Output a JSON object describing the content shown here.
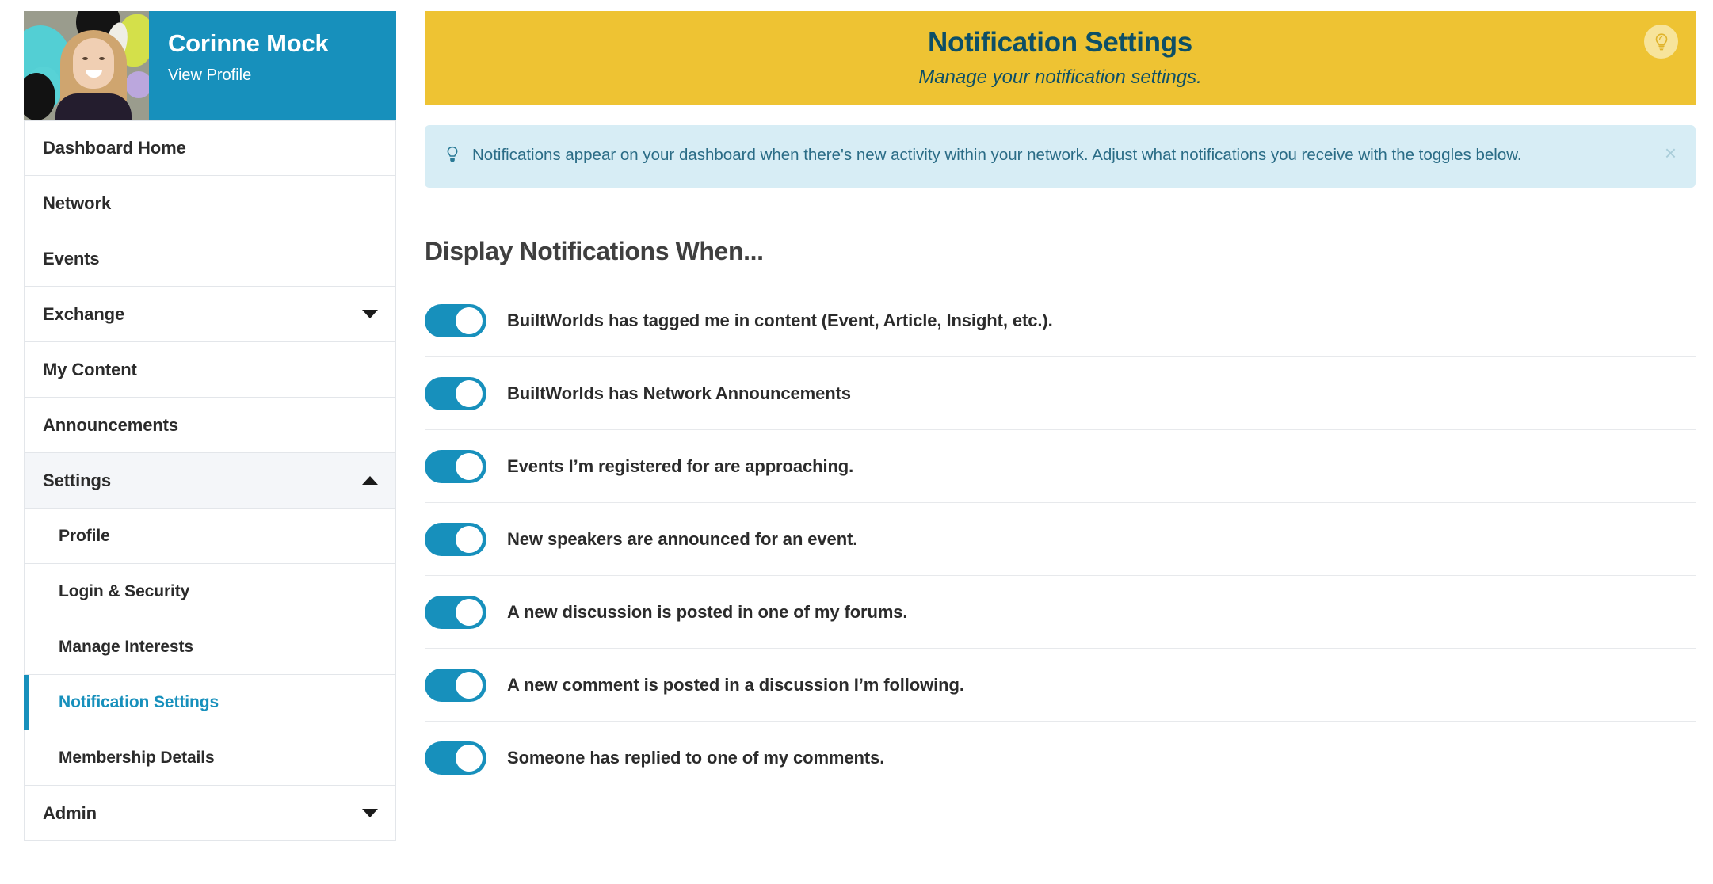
{
  "sidebar": {
    "profile": {
      "name": "Corinne Mock",
      "view_profile_label": "View Profile",
      "avatar_alt": "avatar",
      "background_color": "#1790BC"
    },
    "items": [
      {
        "label": "Dashboard Home",
        "type": "top",
        "caret": "none",
        "state": "default"
      },
      {
        "label": "Network",
        "type": "top",
        "caret": "none",
        "state": "default"
      },
      {
        "label": "Events",
        "type": "top",
        "caret": "none",
        "state": "default"
      },
      {
        "label": "Exchange",
        "type": "top",
        "caret": "down",
        "state": "default"
      },
      {
        "label": "My Content",
        "type": "top",
        "caret": "none",
        "state": "default"
      },
      {
        "label": "Announcements",
        "type": "top",
        "caret": "none",
        "state": "default"
      },
      {
        "label": "Settings",
        "type": "top",
        "caret": "up",
        "state": "expanded"
      },
      {
        "label": "Profile",
        "type": "sub",
        "caret": "none",
        "state": "default"
      },
      {
        "label": "Login & Security",
        "type": "sub",
        "caret": "none",
        "state": "default"
      },
      {
        "label": "Manage Interests",
        "type": "sub",
        "caret": "none",
        "state": "default"
      },
      {
        "label": "Notification Settings",
        "type": "sub",
        "caret": "none",
        "state": "active"
      },
      {
        "label": "Membership Details",
        "type": "sub",
        "caret": "none",
        "state": "default"
      },
      {
        "label": "Admin",
        "type": "top",
        "caret": "down",
        "state": "default"
      }
    ]
  },
  "hero": {
    "title": "Notification Settings",
    "subtitle": "Manage your notification settings.",
    "background_color": "#EEC333",
    "text_color": "#0d4f66",
    "badge_icon": "lightbulb-icon"
  },
  "info_banner": {
    "icon": "lightbulb-icon",
    "text": "Notifications appear on your dashboard when there's new activity within your network. Adjust what notifications you receive with the toggles below.",
    "close_label": "×",
    "background_color": "#d7edf5",
    "text_color": "#2a6c86"
  },
  "notifications": {
    "section_title": "Display Notifications When...",
    "toggle_on_color": "#1790BC",
    "items": [
      {
        "label": "BuiltWorlds has tagged me in content (Event, Article, Insight, etc.).",
        "enabled": true
      },
      {
        "label": "BuiltWorlds has Network Announcements",
        "enabled": true
      },
      {
        "label": "Events I’m registered for are approaching.",
        "enabled": true
      },
      {
        "label": "New speakers are announced for an event.",
        "enabled": true
      },
      {
        "label": "A new discussion is posted in one of my forums.",
        "enabled": true
      },
      {
        "label": "A new comment is posted in a discussion I’m following.",
        "enabled": true
      },
      {
        "label": "Someone has replied to one of my comments.",
        "enabled": true
      }
    ]
  }
}
